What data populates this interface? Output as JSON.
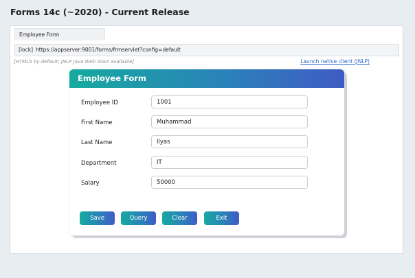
{
  "page": {
    "title": "Forms 14c (~2020) - Current Release"
  },
  "browser": {
    "tab_label": "Employee Form",
    "lock_label": "[lock]",
    "url": "https://appserver:9001/forms/frmservlet?config=default",
    "note": "[HTML5 by default; JNLP Java Web Start available]",
    "jnlp_link": "Launch native client (JNLP)"
  },
  "form": {
    "title": "Employee Form",
    "fields": [
      {
        "label": "Employee ID",
        "value": "1001"
      },
      {
        "label": "First Name",
        "value": "Muhammad"
      },
      {
        "label": "Last Name",
        "value": "Ilyas"
      },
      {
        "label": "Department",
        "value": "IT"
      },
      {
        "label": "Salary",
        "value": "50000"
      }
    ],
    "buttons": {
      "save": "Save",
      "query": "Query",
      "clear": "Clear",
      "exit": "Exit"
    }
  },
  "colors": {
    "accent_start": "#16aa9f",
    "accent_end": "#3f5bc5",
    "link": "#2a66c8"
  }
}
